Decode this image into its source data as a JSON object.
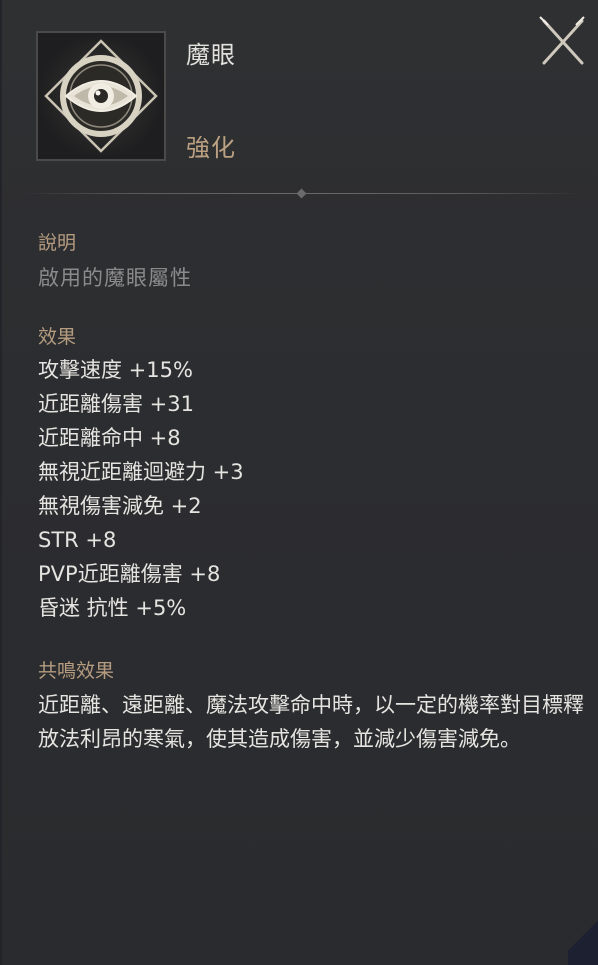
{
  "item": {
    "name": "魔眼",
    "type": "強化",
    "icon": "magic-eye-icon"
  },
  "close_icon": "close-icon",
  "description": {
    "label": "說明",
    "text": "啟用的魔眼屬性"
  },
  "effects": {
    "label": "效果",
    "items": [
      "攻擊速度 +15%",
      "近距離傷害 +31",
      "近距離命中 +8",
      "無視近距離迴避力 +3",
      "無視傷害減免 +2",
      "STR +8",
      "PVP近距離傷害 +8",
      "昏迷 抗性 +5%"
    ]
  },
  "resonance": {
    "label": "共鳴效果",
    "text": "近距離、遠距離、魔法攻擊命中時，以一定的機率對目標釋放法利昂的寒氣，使其造成傷害，並減少傷害減免。"
  },
  "colors": {
    "panel_bg": "#2e2f31",
    "label_gold": "#b59c80",
    "type_gold": "#bba182",
    "text_white": "#e6e4e0",
    "text_grey": "#8b8b8b"
  }
}
